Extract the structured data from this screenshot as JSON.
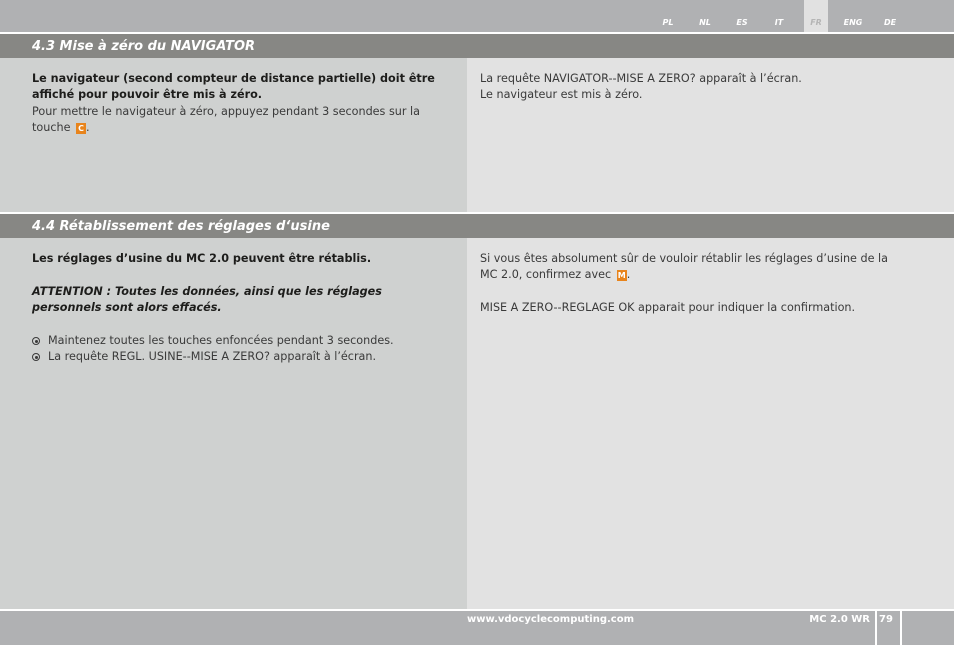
{
  "languages": [
    {
      "code": "PL",
      "active": false
    },
    {
      "code": "NL",
      "active": false
    },
    {
      "code": "ES",
      "active": false
    },
    {
      "code": "IT",
      "active": false
    },
    {
      "code": "FR",
      "active": true
    },
    {
      "code": "ENG",
      "active": false
    },
    {
      "code": "DE",
      "active": false
    }
  ],
  "section_43": {
    "title": "4.3 Mise à zéro du NAVIGATOR",
    "left": {
      "bold_intro": "Le navigateur (second compteur de distance partielle) doit être affiché pour pouvoir être mis à zéro.",
      "body_before_key": "Pour mettre le navigateur à zéro, appuyez pendant 3 secondes sur la touche",
      "key": "C",
      "body_after_key": "."
    },
    "right": {
      "line1": "La requête NAVIGATOR--MISE A ZERO? apparaît à l’écran.",
      "line2": "Le navigateur est mis à zéro."
    }
  },
  "section_44": {
    "title": "4.4 Rétablissement des réglages d‘usine",
    "left": {
      "bold_intro": "Les réglages d’usine du MC 2.0 peuvent être rétablis.",
      "attention": "ATTENTION : Toutes les données, ainsi que les réglages personnels sont alors effacés.",
      "bullets": [
        "Maintenez toutes les touches enfoncées pendant 3 secondes.",
        "La requête REGL. USINE--MISE A ZERO? apparaît à l’écran."
      ]
    },
    "right": {
      "body_before_key": "Si vous êtes absolument sûr de vouloir rétablir les réglages d’usine de la MC 2.0, confirmez avec",
      "key": "M",
      "body_after_key": ".",
      "confirmation": "MISE A ZERO--REGLAGE OK apparait pour indiquer la confirmation."
    }
  },
  "footer": {
    "url": "www.vdocyclecomputing.com",
    "model": "MC 2.0 WR",
    "page": "79"
  },
  "colors": {
    "key_orange": "#e8841c",
    "section_bar": "#878784",
    "top_bar": "#b0b1b3"
  }
}
